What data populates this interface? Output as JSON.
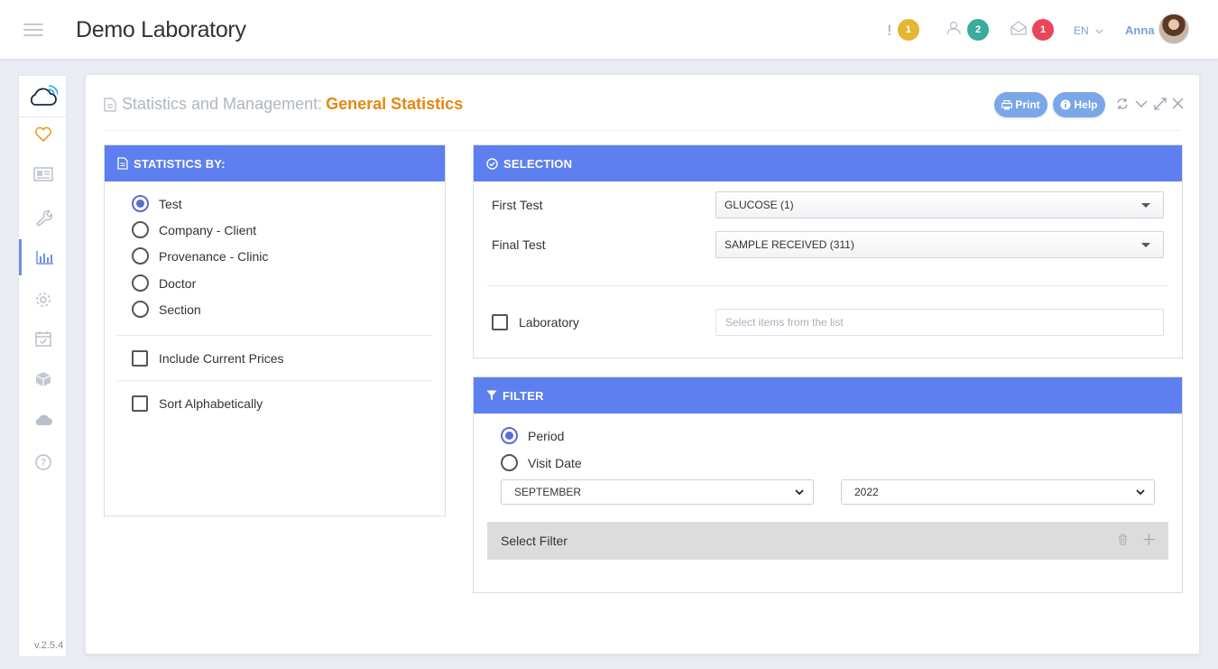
{
  "header": {
    "app_title": "Demo Laboratory",
    "alerts": {
      "icon": "exclamation-icon",
      "count": "1",
      "color": "#e3b633"
    },
    "users": {
      "icon": "users-icon",
      "count": "2",
      "color": "#3aab9c"
    },
    "messages": {
      "icon": "envelope-icon",
      "count": "1",
      "color": "#e9465a"
    },
    "language": "EN",
    "user_name": "Anna"
  },
  "sidebar": {
    "items": [
      {
        "icon": "heart-icon"
      },
      {
        "icon": "news-icon"
      },
      {
        "icon": "wrench-icon"
      },
      {
        "icon": "bar-chart-icon",
        "active": true
      },
      {
        "icon": "gear-icon"
      },
      {
        "icon": "calendar-check-icon"
      },
      {
        "icon": "cube-icon"
      },
      {
        "icon": "cloud-icon"
      },
      {
        "icon": "help-icon"
      }
    ],
    "version": "v.2.5.4"
  },
  "page": {
    "title_prefix": "Statistics and Management:",
    "title_main": "General Statistics",
    "print_label": "Print",
    "help_label": "Help"
  },
  "statistics_by": {
    "heading": "STATISTICS BY:",
    "options": [
      {
        "label": "Test",
        "selected": true
      },
      {
        "label": "Company - Client",
        "selected": false
      },
      {
        "label": "Provenance - Clinic",
        "selected": false
      },
      {
        "label": "Doctor",
        "selected": false
      },
      {
        "label": "Section",
        "selected": false
      }
    ],
    "include_prices_label": "Include Current Prices",
    "sort_label": "Sort Alphabetically"
  },
  "selection": {
    "heading": "SELECTION",
    "first_test_label": "First Test",
    "first_test_value": "GLUCOSE (1)",
    "final_test_label": "Final Test",
    "final_test_value": "SAMPLE RECEIVED (311)",
    "laboratory_label": "Laboratory",
    "laboratory_placeholder": "Select items from the list"
  },
  "filter": {
    "heading": "FILTER",
    "options": [
      {
        "label": "Period",
        "selected": true
      },
      {
        "label": "Visit Date",
        "selected": false
      }
    ],
    "month": "SEPTEMBER",
    "year": "2022",
    "select_filter_label": "Select Filter"
  },
  "colors": {
    "panel_header": "#5d7ff0",
    "accent_title": "#e5870f",
    "pill_button": "#7ba7e8"
  }
}
